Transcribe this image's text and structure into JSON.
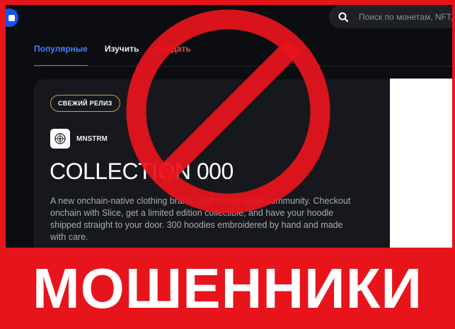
{
  "header": {
    "search_placeholder": "Поиск по монетам, NFT, и"
  },
  "tabs": [
    {
      "label": "Популярные",
      "active": true
    },
    {
      "label": "Изучить",
      "active": false
    },
    {
      "label": "Создать",
      "active": false
    }
  ],
  "hero": {
    "badge": "СВЕЖИЙ РЕЛИЗ",
    "brand_name": "MNSTRM",
    "title": "COLLECTION 000",
    "description": "A new onchain-native clothing brand, built for the Base community. Checkout onchain with Slice, get a limited edition collectible, and have your hoodle shipped straight to your door. 300 hoodies embroidered by hand and made with care."
  },
  "overlay": {
    "caption": "МОШЕННИКИ",
    "sign_color": "#e8141c"
  },
  "colors": {
    "frame": "#e8141c",
    "accent": "#4a7dff",
    "background": "#0c0d11",
    "card": "#16181d",
    "badge_border": "#c8a246"
  }
}
